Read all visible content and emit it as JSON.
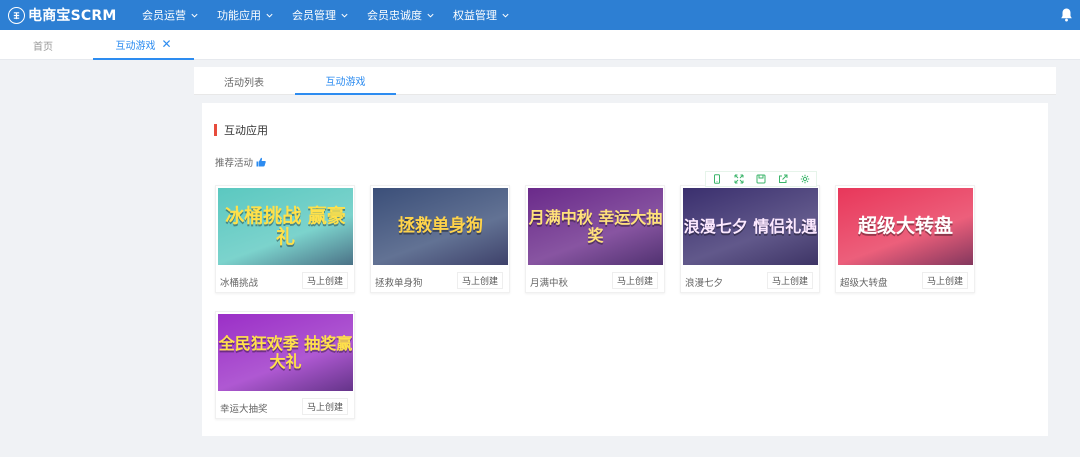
{
  "app": {
    "logo_text": "电商宝SCRM"
  },
  "nav": [
    {
      "label": "会员运营"
    },
    {
      "label": "功能应用"
    },
    {
      "label": "会员管理"
    },
    {
      "label": "会员忠诚度"
    },
    {
      "label": "权益管理"
    }
  ],
  "page_tabs": {
    "home": "首页",
    "active": "互动游戏"
  },
  "sub_tabs": {
    "list": "活动列表",
    "games": "互动游戏"
  },
  "section": {
    "title": "互动应用",
    "recommend": "推荐活动"
  },
  "create_label": "马上创建",
  "cards": [
    {
      "name": "冰桶挑战",
      "art": "冰桶挑战 赢豪礼",
      "bg": "#5bc8c0"
    },
    {
      "name": "拯救单身狗",
      "art": "拯救单身狗",
      "bg": "#3b4f79"
    },
    {
      "name": "月满中秋",
      "art": "月满中秋 幸运大抽奖",
      "bg": "#6a2a8a"
    },
    {
      "name": "浪漫七夕",
      "art": "浪漫七夕 情侣礼遇",
      "bg": "#3a2f6e"
    },
    {
      "name": "超级大转盘",
      "art": "超级大转盘",
      "bg": "#e8375a"
    },
    {
      "name": "幸运大抽奖",
      "art": "全民狂欢季 抽奖赢大礼",
      "bg": "#9b2fc7"
    }
  ],
  "colors": {
    "primary": "#2d7fd3",
    "accent": "#2d8cf0",
    "section_bar": "#e74c3c"
  },
  "icons": {
    "logo": "coin-icon",
    "bell": "bell-icon",
    "thumb": "thumbs-up-icon"
  }
}
